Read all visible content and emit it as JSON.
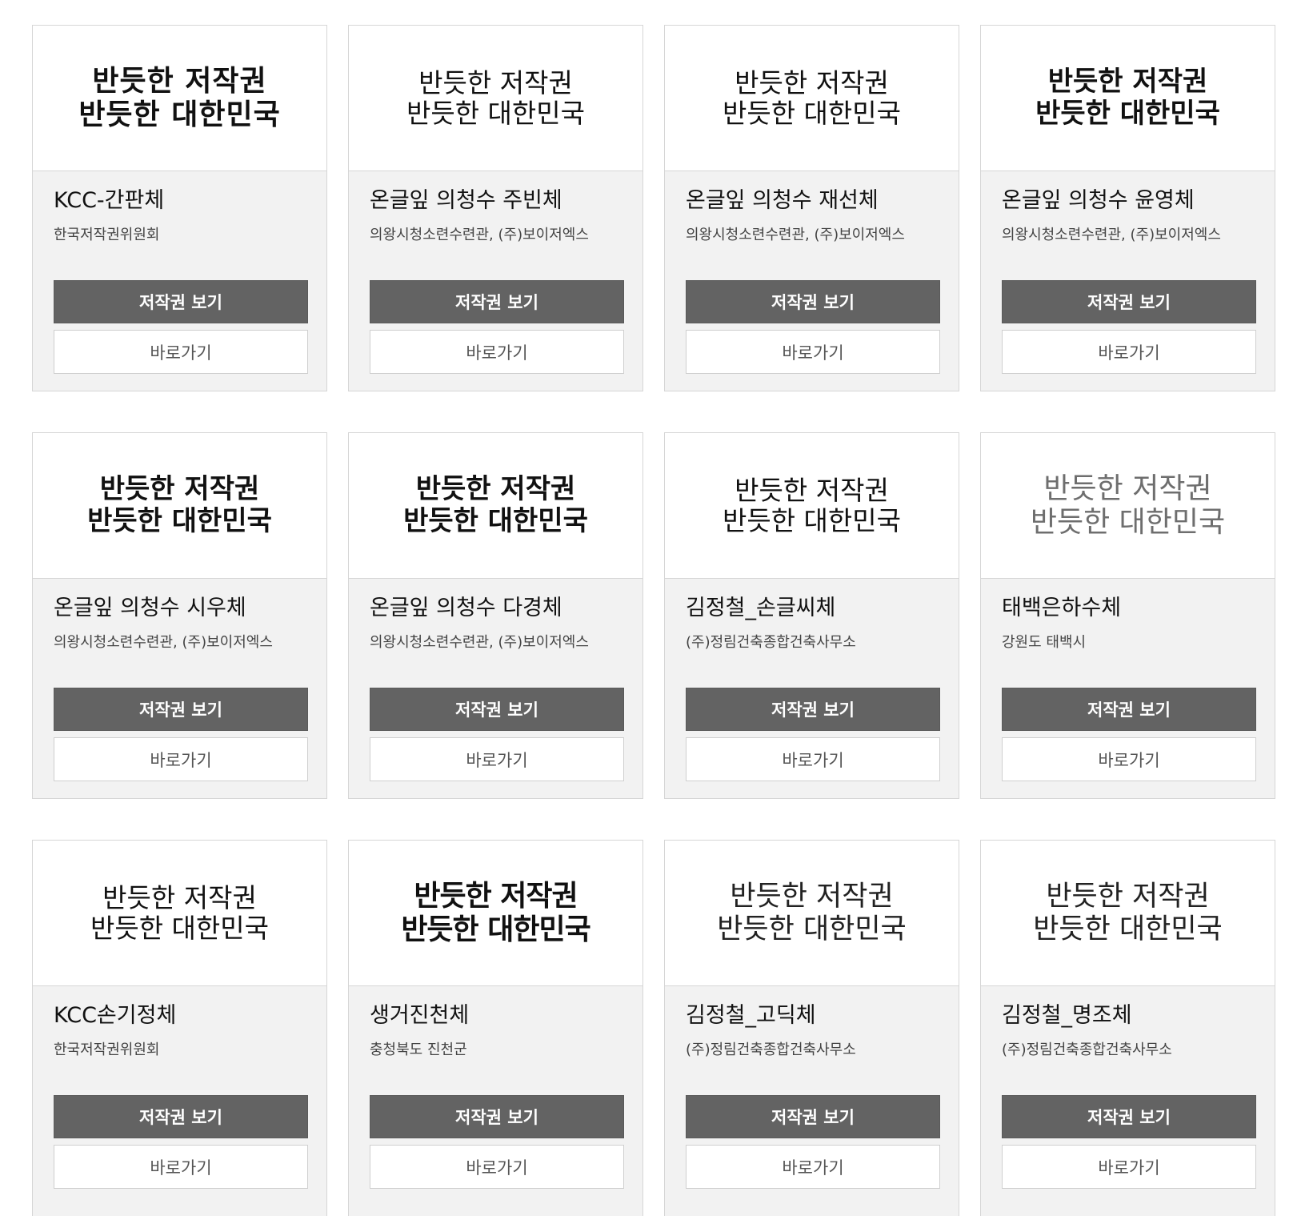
{
  "fonts": [
    {
      "preview_lines": [
        "반듯한 저작권",
        "반듯한 대한민국"
      ],
      "name": "KCC-간판체",
      "maker": "한국저작권위원회",
      "copyright_label": "저작권 보기",
      "go_label": "바로가기"
    },
    {
      "preview_lines": [
        "반듯한 저작권",
        "반듯한 대한민국"
      ],
      "name": "온글잎 의청수 주빈체",
      "maker": "의왕시청소련수련관, (주)보이저엑스",
      "copyright_label": "저작권 보기",
      "go_label": "바로가기"
    },
    {
      "preview_lines": [
        "반듯한 저작권",
        "반듯한 대한민국"
      ],
      "name": "온글잎 의청수 재선체",
      "maker": "의왕시청소련수련관, (주)보이저엑스",
      "copyright_label": "저작권 보기",
      "go_label": "바로가기"
    },
    {
      "preview_lines": [
        "반듯한 저작권",
        "반듯한 대한민국"
      ],
      "name": "온글잎 의청수 윤영체",
      "maker": "의왕시청소련수련관, (주)보이저엑스",
      "copyright_label": "저작권 보기",
      "go_label": "바로가기"
    },
    {
      "preview_lines": [
        "반듯한 저작권",
        "반듯한 대한민국"
      ],
      "name": "온글잎 의청수 시우체",
      "maker": "의왕시청소련수련관, (주)보이저엑스",
      "copyright_label": "저작권 보기",
      "go_label": "바로가기"
    },
    {
      "preview_lines": [
        "반듯한 저작권",
        "반듯한 대한민국"
      ],
      "name": "온글잎 의청수 다경체",
      "maker": "의왕시청소련수련관, (주)보이저엑스",
      "copyright_label": "저작권 보기",
      "go_label": "바로가기"
    },
    {
      "preview_lines": [
        "반듯한 저작권",
        "반듯한 대한민국"
      ],
      "name": "김정철_손글씨체",
      "maker": "(주)정림건축종합건축사무소",
      "copyright_label": "저작권 보기",
      "go_label": "바로가기"
    },
    {
      "preview_lines": [
        "반듯한 저작권",
        "반듯한 대한민국"
      ],
      "name": "태백은하수체",
      "maker": "강원도 태백시",
      "copyright_label": "저작권 보기",
      "go_label": "바로가기"
    },
    {
      "preview_lines": [
        "반듯한 저작권",
        "반듯한 대한민국"
      ],
      "name": "KCC손기정체",
      "maker": "한국저작권위원회",
      "copyright_label": "저작권 보기",
      "go_label": "바로가기"
    },
    {
      "preview_lines": [
        "반듯한 저작권",
        "반듯한 대한민국"
      ],
      "name": "생거진천체",
      "maker": "충청북도 진천군",
      "copyright_label": "저작권 보기",
      "go_label": "바로가기"
    },
    {
      "preview_lines": [
        "반듯한 저작권",
        "반듯한 대한민국"
      ],
      "name": "김정철_고딕체",
      "maker": "(주)정림건축종합건축사무소",
      "copyright_label": "저작권 보기",
      "go_label": "바로가기"
    },
    {
      "preview_lines": [
        "반듯한 저작권",
        "반듯한 대한민국"
      ],
      "name": "김정철_명조체",
      "maker": "(주)정림건축종합건축사무소",
      "copyright_label": "저작권 보기",
      "go_label": "바로가기"
    }
  ]
}
